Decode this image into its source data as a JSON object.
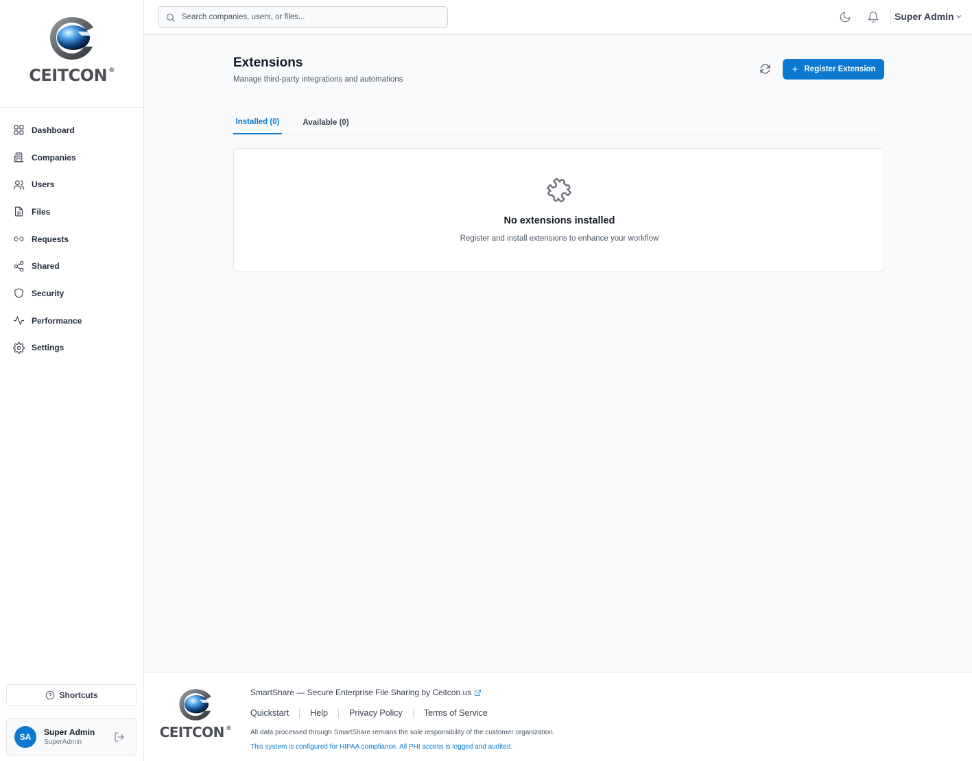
{
  "brand": {
    "name": "CEITCON",
    "mark": "®"
  },
  "header": {
    "search_placeholder": "Search companies, users, or files...",
    "user_menu_label": "Super Admin"
  },
  "sidebar": {
    "items": [
      {
        "label": "Dashboard",
        "icon": "grid-icon"
      },
      {
        "label": "Companies",
        "icon": "building-icon"
      },
      {
        "label": "Users",
        "icon": "users-icon"
      },
      {
        "label": "Files",
        "icon": "file-icon"
      },
      {
        "label": "Requests",
        "icon": "link-icon"
      },
      {
        "label": "Shared",
        "icon": "share-icon"
      },
      {
        "label": "Security",
        "icon": "shield-icon"
      },
      {
        "label": "Performance",
        "icon": "activity-icon"
      },
      {
        "label": "Settings",
        "icon": "gear-icon"
      }
    ],
    "shortcuts_label": "Shortcuts",
    "user": {
      "initials": "SA",
      "name": "Super Admin",
      "role": "SuperAdmin"
    }
  },
  "main": {
    "title": "Extensions",
    "subtitle": "Manage third-party integrations and automations",
    "register_button": "Register Extension",
    "tabs": [
      {
        "label": "Installed (0)",
        "active": true
      },
      {
        "label": "Available (0)",
        "active": false
      }
    ],
    "empty_state": {
      "title": "No extensions installed",
      "subtitle": "Register and install extensions to enhance your workflow"
    }
  },
  "footer": {
    "tagline": "SmartShare — Secure Enterprise File Sharing by Ceitcon.us",
    "links": [
      "Quickstart",
      "Help",
      "Privacy Policy",
      "Terms of Service"
    ],
    "note": "All data processed through SmartShare remains the sole responsibility of the customer organization.",
    "hipaa": "This system is configured for HIPAA compliance. All PHI access is logged and audited."
  },
  "colors": {
    "accent": "#0b79d0",
    "border": "#e5e7eb",
    "background": "#f9fafb"
  }
}
